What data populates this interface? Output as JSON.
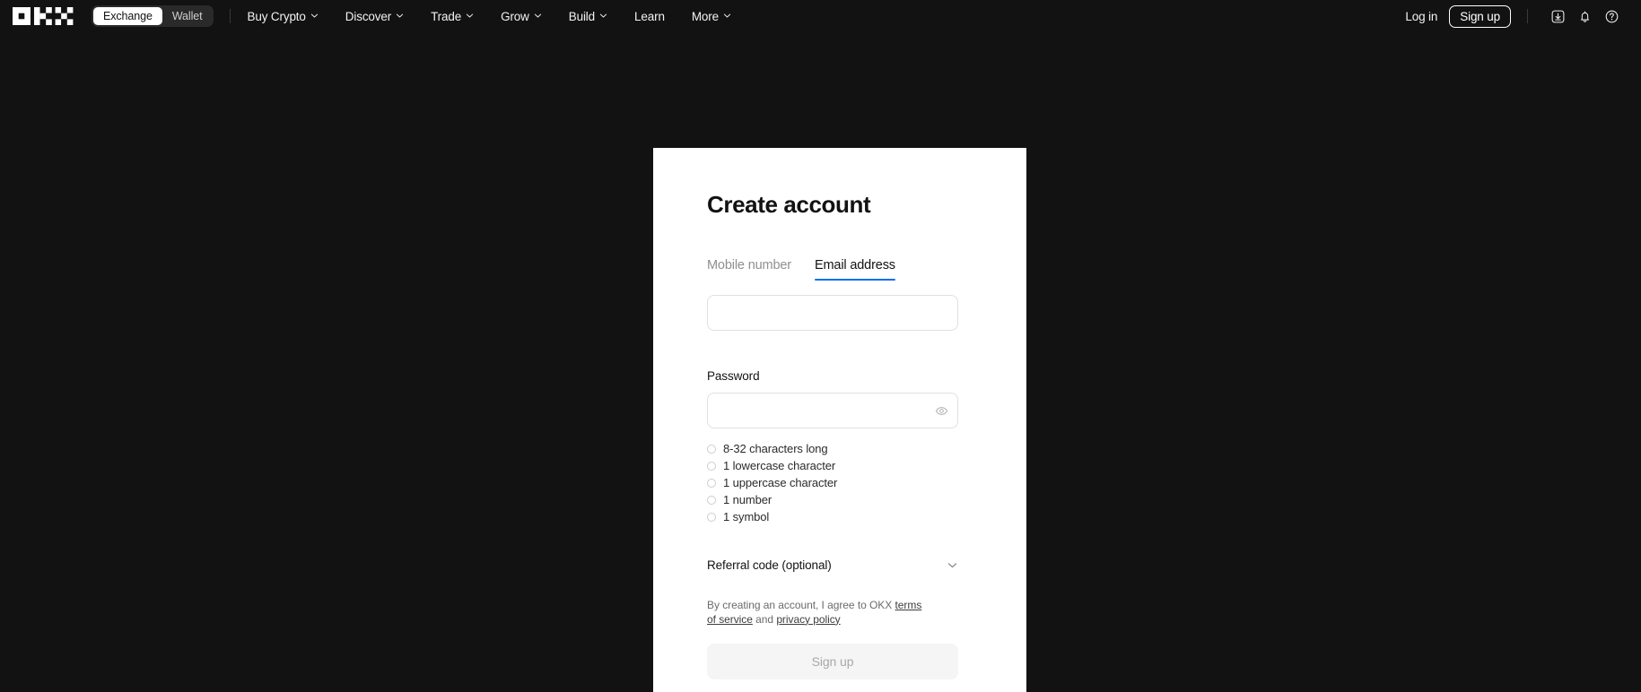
{
  "theme": {
    "accent": "#0c6ef2",
    "header_bg": "#121212",
    "page_bg": "#121212",
    "card_bg": "#ffffff",
    "text_dark": "#121212",
    "text_muted": "#8f8f8f",
    "disabled_btn_bg": "#f5f5f5",
    "disabled_btn_text": "#a8a8ad"
  },
  "header": {
    "logo_name": "okx-logo",
    "product_switch": {
      "selected": "Exchange",
      "options": [
        {
          "label": "Exchange",
          "active": true
        },
        {
          "label": "Wallet",
          "active": false
        }
      ]
    },
    "nav_items": [
      {
        "label": "Buy Crypto",
        "has_chevron": true
      },
      {
        "label": "Discover",
        "has_chevron": true
      },
      {
        "label": "Trade",
        "has_chevron": true
      },
      {
        "label": "Grow",
        "has_chevron": true
      },
      {
        "label": "Build",
        "has_chevron": true
      },
      {
        "label": "Learn",
        "has_chevron": false
      },
      {
        "label": "More",
        "has_chevron": true
      }
    ],
    "login_label": "Log in",
    "signup_label": "Sign up",
    "icons": [
      {
        "name": "download-icon"
      },
      {
        "name": "notification-bell-icon"
      },
      {
        "name": "help-circle-icon"
      }
    ]
  },
  "card": {
    "title": "Create account",
    "tabs": [
      {
        "label": "Mobile number",
        "active": false
      },
      {
        "label": "Email address",
        "active": true
      }
    ],
    "email_field": {
      "value": "",
      "placeholder": ""
    },
    "password": {
      "label": "Password",
      "value": "",
      "placeholder": "",
      "toggle_icon": "eye-icon",
      "requirements": [
        "8-32 characters long",
        "1 lowercase character",
        "1 uppercase character",
        "1 number",
        "1 symbol"
      ]
    },
    "referral": {
      "label": "Referral code (optional)",
      "chevron_icon": "chevron-down-icon",
      "expanded": false
    },
    "terms": {
      "prefix": "By creating an account, I agree to OKX ",
      "link1": "terms of service",
      "middle": " and ",
      "link2": "privacy policy"
    },
    "submit_label": "Sign up"
  }
}
